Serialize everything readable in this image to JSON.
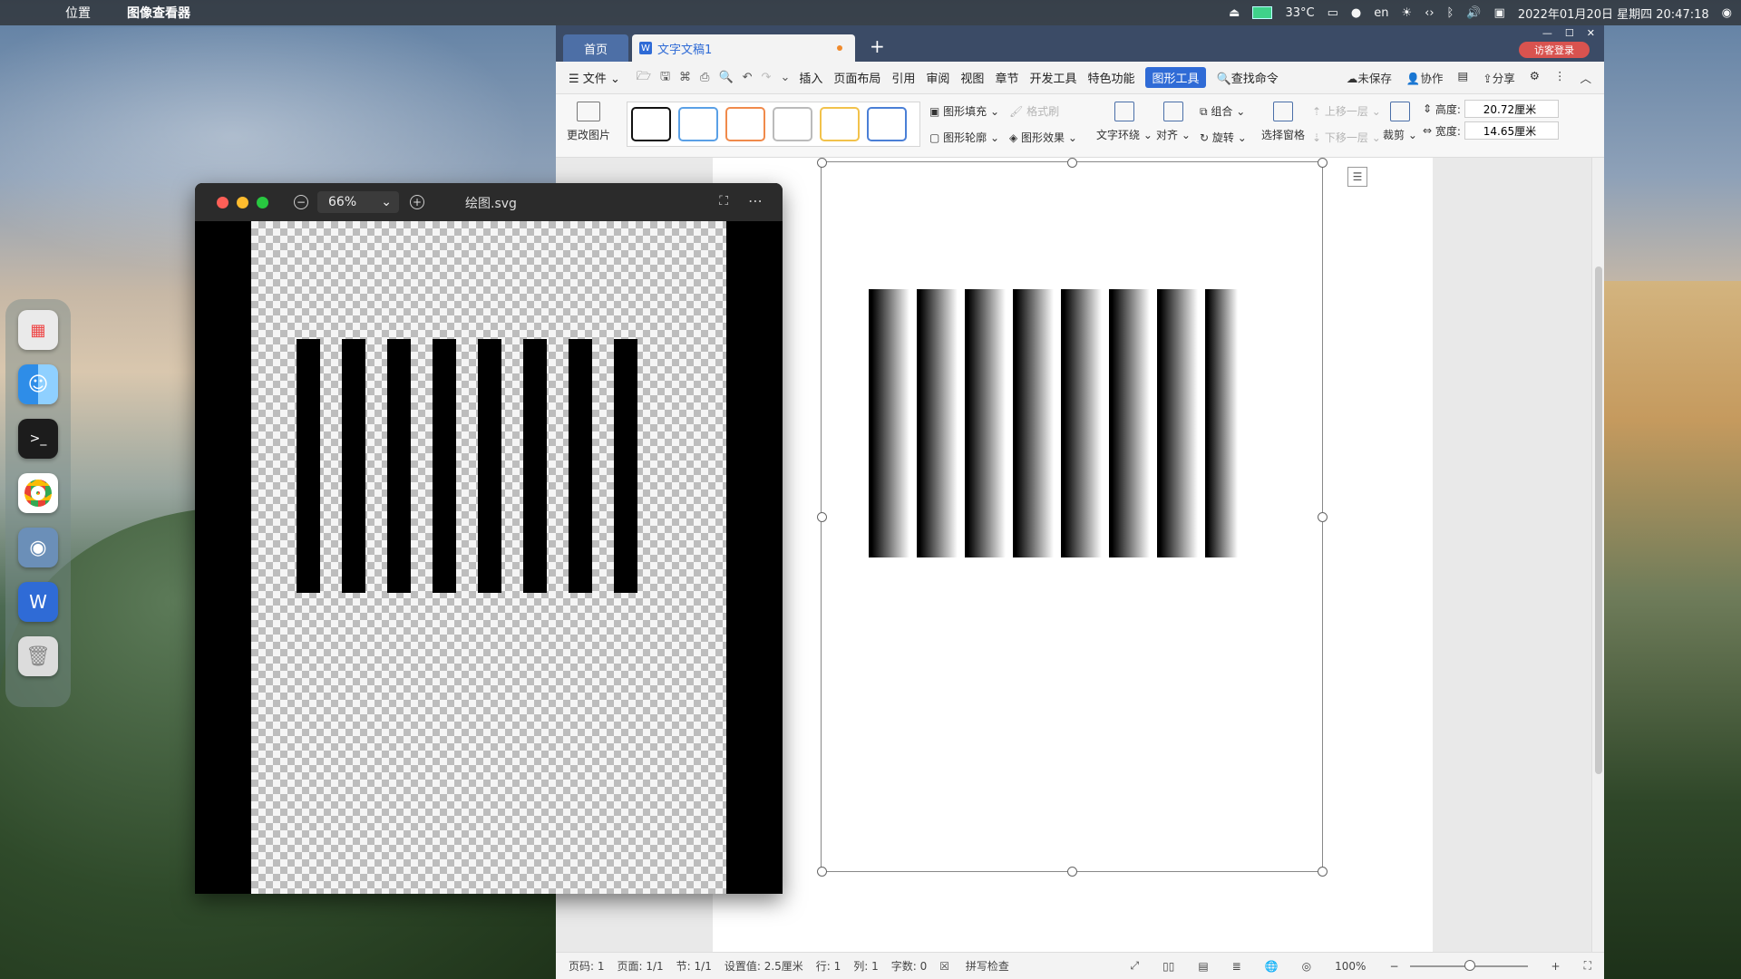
{
  "menubar": {
    "apple": "",
    "location": "位置",
    "app_name": "图像查看器",
    "temperature": "33",
    "input_method": "en",
    "datetime": "2022年01月20日 星期四 20:47:18"
  },
  "dock": {
    "items": [
      "launchpad-icon",
      "finder-icon",
      "terminal-icon",
      "chrome-icon",
      "screenshot-icon",
      "wps-icon",
      "trash-icon"
    ]
  },
  "viewer": {
    "zoom": "66%",
    "filename": "绘图.svg",
    "bar_count": 8
  },
  "wps": {
    "tabs": {
      "home": "首页",
      "doc": "文字文稿1",
      "login": "访客登录"
    },
    "menu": {
      "file": "文件",
      "items": [
        "插入",
        "页面布局",
        "引用",
        "审阅",
        "视图",
        "章节",
        "开发工具",
        "特色功能"
      ],
      "active_tool": "图形工具",
      "search": "查找命令",
      "unsaved": "未保存",
      "collab": "协作",
      "share": "分享"
    },
    "ribbon": {
      "change_picture": "更改图片",
      "style_colors": [
        "#111111",
        "#5aa0e6",
        "#f08a4b",
        "#bbbbbb",
        "#f2c24b",
        "#4a7fd6"
      ],
      "shape_fill": "图形填充",
      "format_brush": "格式刷",
      "shape_outline": "图形轮廓",
      "shape_effect": "图形效果",
      "text_wrap": "文字环绕",
      "align": "对齐",
      "group": "组合",
      "rotate": "旋转",
      "select_pane": "选择窗格",
      "bring_forward": "上移一层",
      "send_backward": "下移一层",
      "crop": "裁剪",
      "height_label": "高度:",
      "height_value": "20.72厘米",
      "width_label": "宽度:",
      "width_value": "14.65厘米"
    },
    "status": {
      "page_num": "页码: 1",
      "pages": "页面: 1/1",
      "section": "节: 1/1",
      "setting": "设置值: 2.5厘米",
      "row": "行: 1",
      "col": "列: 1",
      "words": "字数: 0",
      "spell": "拼写检查",
      "zoom": "100%"
    }
  }
}
